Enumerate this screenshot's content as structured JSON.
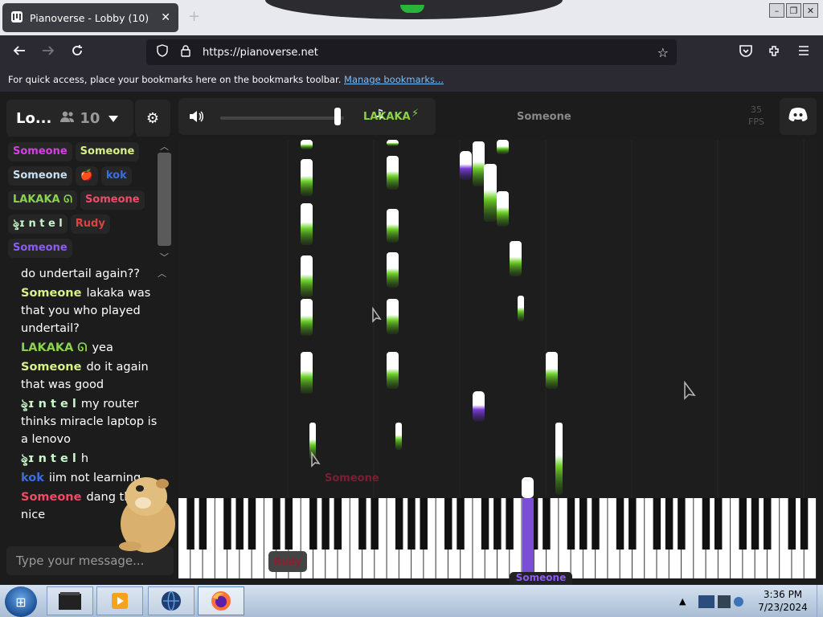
{
  "browser": {
    "tab_title": "Pianoverse - Lobby (10)",
    "tab_close": "✕",
    "new_tab": "+",
    "url": "https://pianoverse.net",
    "bookmarks_text": "For quick access, place your bookmarks here on the bookmarks toolbar.",
    "bookmarks_link": "Manage bookmarks..."
  },
  "lobby": {
    "name": "Lo...",
    "user_count": "10",
    "users": [
      {
        "name": "Someone",
        "color": "#d63ee6"
      },
      {
        "name": "Someone",
        "color": "#d8f08a"
      },
      {
        "name": "Someone",
        "color": "#c8dff0"
      },
      {
        "name": "🍎",
        "color": "#e53935"
      },
      {
        "name": "kok",
        "color": "#3a6ddf"
      },
      {
        "name": "LAKAKA ᘏ",
        "color": "#8bd34c"
      },
      {
        "name": "Someone",
        "color": "#ef4a67"
      },
      {
        "name": "ৡɪ n t e l",
        "color": "#c9f7cc"
      },
      {
        "name": "Rudy",
        "color": "#e04040"
      },
      {
        "name": "Someone",
        "color": "#8b5cf6"
      }
    ]
  },
  "chat": {
    "messages": [
      {
        "user": "",
        "color": "#ffffff",
        "text": "do undertail again??"
      },
      {
        "user": "Someone",
        "color": "#d8f08a",
        "text": "lakaka was that you who played undertail?"
      },
      {
        "user": "LAKAKA ᘏ",
        "color": "#8bd34c",
        "text": "yea"
      },
      {
        "user": "Someone",
        "color": "#d8f08a",
        "text": "do it again that was good"
      },
      {
        "user": "ৡɪ n t e l",
        "color": "#c9f7cc",
        "text": "my router thinks miracle laptop is a lenovo"
      },
      {
        "user": "ৡɪ n t e l",
        "color": "#c9f7cc",
        "text": "h"
      },
      {
        "user": "kok",
        "color": "#3a6ddf",
        "text": "iim not learning"
      },
      {
        "user": "Someone",
        "color": "#ef4a67",
        "text": "dang thats nice"
      }
    ],
    "placeholder": "Type your message..."
  },
  "controls": {
    "volume_percent": 95,
    "lakaka_tag": "LAKAKA",
    "someone_tag": "Someone",
    "fps_value": "35",
    "fps_label": "FPS"
  },
  "roll_labels": {
    "cursor1": "Someone",
    "cursor2": "Someone",
    "cursor3": "Rudy"
  },
  "taskbar": {
    "time": "3:36 PM",
    "date": "7/23/2024"
  }
}
